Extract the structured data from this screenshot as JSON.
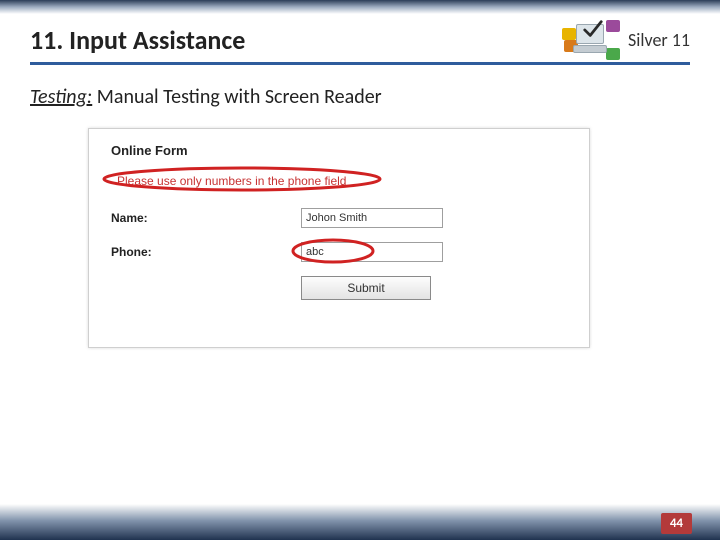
{
  "header": {
    "title": "11. Input Assistance",
    "level": "Silver 11"
  },
  "subhead": {
    "label": "Testing:",
    "text": "Manual Testing with Screen Reader"
  },
  "form": {
    "title": "Online Form",
    "error": "Please use only numbers in the phone field",
    "name_label": "Name:",
    "name_value": "Johon Smith",
    "phone_label": "Phone:",
    "phone_value": "abc",
    "submit_label": "Submit"
  },
  "page_number": "44"
}
